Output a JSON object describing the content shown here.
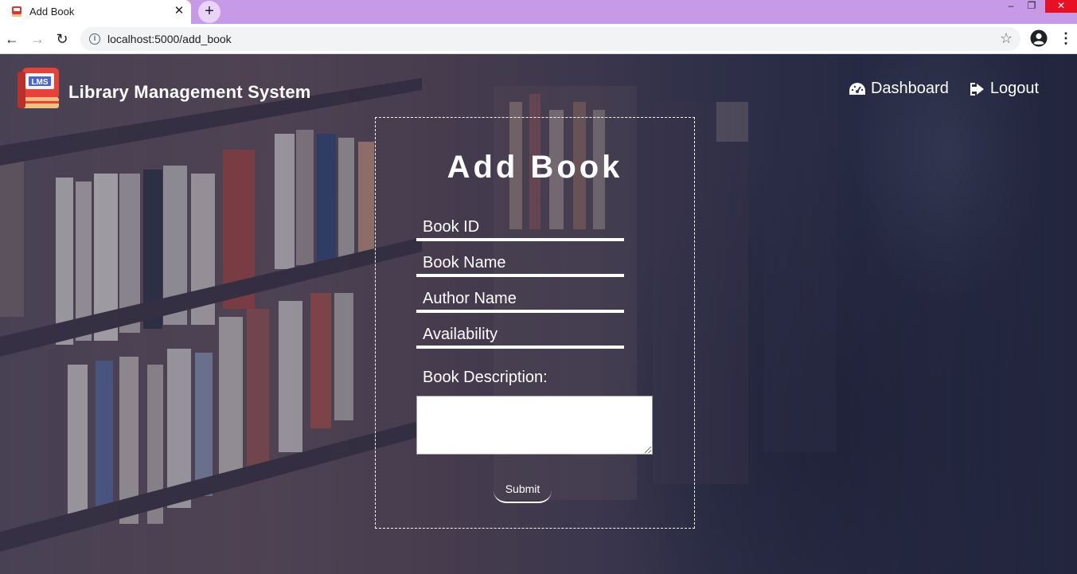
{
  "browser": {
    "tab_title": "Add Book",
    "tab_close": "✕",
    "new_tab": "+",
    "url": "localhost:5000/add_book",
    "window_min": "–",
    "window_max": "❐",
    "window_close": "✕"
  },
  "header": {
    "brand_title": "Library Management System",
    "logo_text": "LMS",
    "nav": [
      {
        "label": "Dashboard",
        "icon": "dashboard-icon"
      },
      {
        "label": "Logout",
        "icon": "logout-icon"
      }
    ]
  },
  "form": {
    "title": "Add Book",
    "fields": [
      {
        "label": "Book ID"
      },
      {
        "label": "Book Name"
      },
      {
        "label": "Author Name"
      },
      {
        "label": "Availability"
      }
    ],
    "description_label": "Book Description:",
    "description_value": "",
    "submit_label": "Submit"
  },
  "colors": {
    "tab_strip": "#c79ae8",
    "text_on_dark": "#ffffff",
    "logo_book": "#e8413a"
  }
}
